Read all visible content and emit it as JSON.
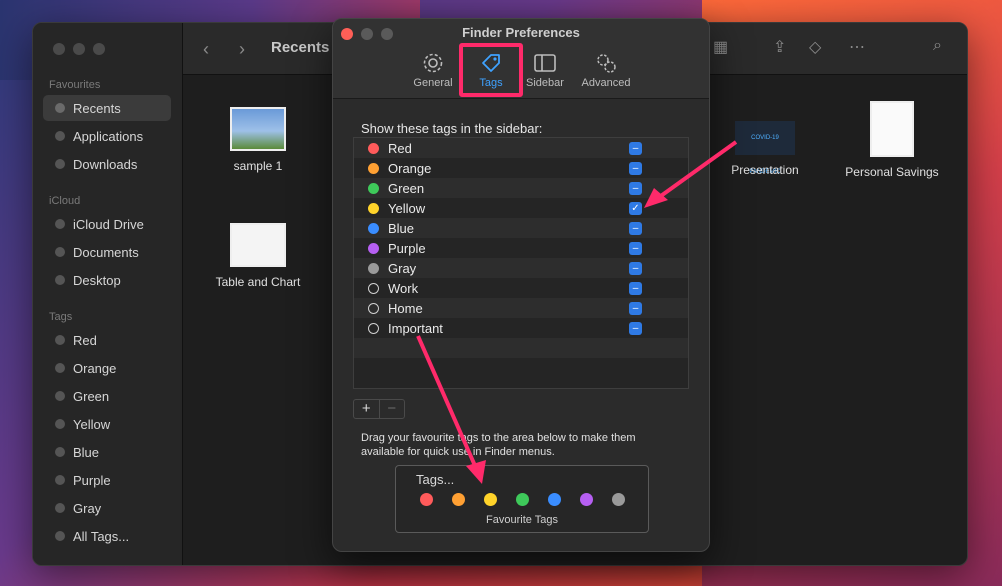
{
  "finder": {
    "title": "Recents",
    "sidebar": {
      "favourites_label": "Favourites",
      "favourites": [
        {
          "label": "Recents"
        },
        {
          "label": "Applications"
        },
        {
          "label": "Downloads"
        }
      ],
      "icloud_label": "iCloud",
      "icloud": [
        {
          "label": "iCloud Drive"
        },
        {
          "label": "Documents"
        },
        {
          "label": "Desktop"
        }
      ],
      "tags_label": "Tags",
      "tags": [
        {
          "label": "Red"
        },
        {
          "label": "Orange"
        },
        {
          "label": "Green"
        },
        {
          "label": "Yellow"
        },
        {
          "label": "Blue"
        },
        {
          "label": "Purple"
        },
        {
          "label": "Gray"
        },
        {
          "label": "All Tags..."
        }
      ]
    },
    "files": [
      {
        "name": "sample 1"
      },
      {
        "name": "Table and Chart"
      },
      {
        "name": "Presentation",
        "thumb_text": "COVID-19 PANDEMIC"
      },
      {
        "name": "Personal Savings"
      }
    ]
  },
  "prefs": {
    "title": "Finder Preferences",
    "tabs": [
      {
        "label": "General",
        "icon": "gear-icon"
      },
      {
        "label": "Tags",
        "icon": "tag-icon"
      },
      {
        "label": "Sidebar",
        "icon": "sidebar-icon"
      },
      {
        "label": "Advanced",
        "icon": "gears-icon"
      }
    ],
    "active_tab": "Tags",
    "section_label": "Show these tags in the sidebar:",
    "tags": [
      {
        "label": "Red",
        "color": "#ff5b5b",
        "checked": false
      },
      {
        "label": "Orange",
        "color": "#ffa033",
        "checked": false
      },
      {
        "label": "Green",
        "color": "#3ec95a",
        "checked": false
      },
      {
        "label": "Yellow",
        "color": "#ffd32a",
        "checked": true
      },
      {
        "label": "Blue",
        "color": "#3a8dff",
        "checked": false
      },
      {
        "label": "Purple",
        "color": "#b65ff2",
        "checked": false
      },
      {
        "label": "Gray",
        "color": "#9a9a9a",
        "checked": false
      },
      {
        "label": "Work",
        "color": "",
        "checked": false
      },
      {
        "label": "Home",
        "color": "",
        "checked": false
      },
      {
        "label": "Important",
        "color": "",
        "checked": false
      }
    ],
    "add_label": "+",
    "remove_label": "−",
    "drag_text": "Drag your favourite tags to the area below to make them available for quick use in Finder menus.",
    "favourites_box": {
      "placeholder": "Tags...",
      "caption": "Favourite Tags",
      "colors": [
        "#ff5b5b",
        "#ffa033",
        "#ffd32a",
        "#3ec95a",
        "#3a8dff",
        "#b65ff2",
        "#9a9a9a"
      ]
    }
  },
  "annotation": {
    "color": "#ff2a6a"
  }
}
